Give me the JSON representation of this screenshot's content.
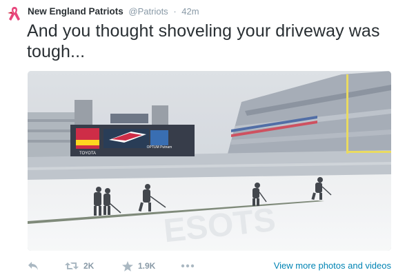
{
  "author": {
    "name": "New England Patriots",
    "handle": "@Patriots",
    "separator": "·",
    "time": "42m"
  },
  "tweet": {
    "text": "And you thought shoveling your driveway was tough..."
  },
  "media": {
    "scoreboard_sponsor": "TOYOTA",
    "scoreboard_right_sponsor": "OPTUM Putnam",
    "endzone_text": "ESOTS"
  },
  "actions": {
    "reply_icon": "reply-icon",
    "retweet_icon": "retweet-icon",
    "retweet_count": "2K",
    "favorite_icon": "star-icon",
    "favorite_count": "1.9K",
    "more_icon": "more-dots-icon",
    "view_more_label": "View more photos and videos"
  },
  "colors": {
    "link": "#0084b4",
    "icon": "#aab8c2",
    "ribbon": "#e8467c"
  }
}
